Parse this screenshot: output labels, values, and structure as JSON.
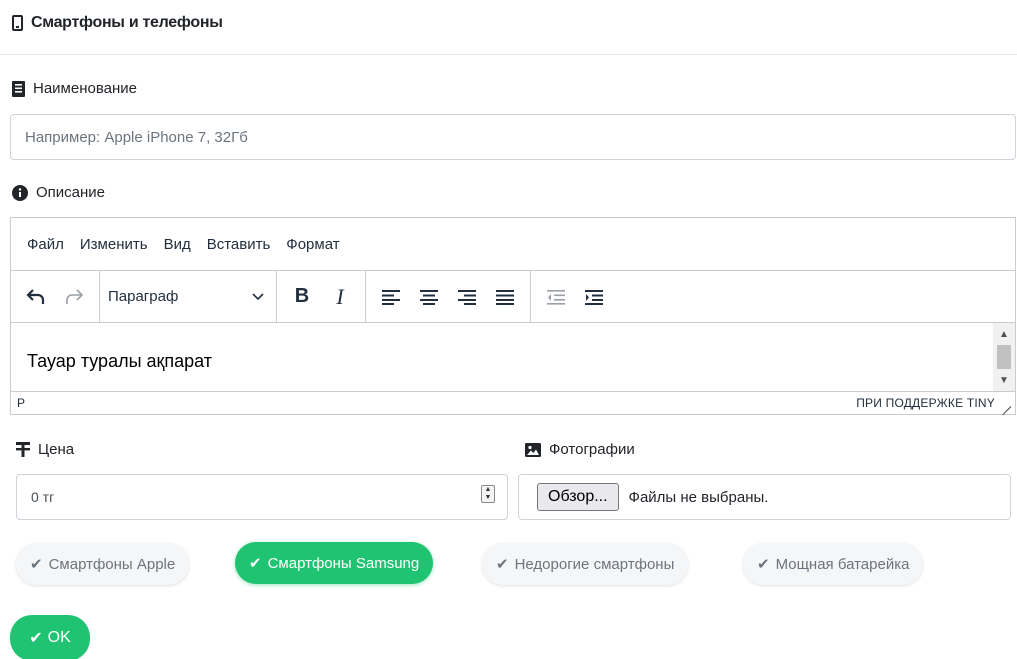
{
  "header": {
    "title": "Смартфоны и телефоны",
    "icon": "phone-icon"
  },
  "name_field": {
    "label": "Наименование",
    "placeholder": "Например: Apple iPhone 7, 32Гб",
    "value": ""
  },
  "description": {
    "label": "Описание",
    "menu": [
      "Файл",
      "Изменить",
      "Вид",
      "Вставить",
      "Формат"
    ],
    "format_select": "Параграф",
    "content": "Тауар туралы ақпарат",
    "status_path": "P",
    "branding": "ПРИ ПОДДЕРЖКЕ TINY"
  },
  "price_field": {
    "label": "Цена",
    "value": "0 тг"
  },
  "photos_field": {
    "label": "Фотографии",
    "button": "Обзор...",
    "status": "Файлы не выбраны."
  },
  "tags": [
    {
      "label": "Смартфоны Apple",
      "active": false
    },
    {
      "label": "Смартфоны Samsung",
      "active": true
    },
    {
      "label": "Недорогие смартфоны",
      "active": false
    },
    {
      "label": "Мощная батарейка",
      "active": false
    }
  ],
  "submit": {
    "label": "OK"
  },
  "colors": {
    "accent": "#20c372",
    "border": "#ced4da",
    "editor_border": "#cccccc",
    "muted": "#6c757d"
  }
}
